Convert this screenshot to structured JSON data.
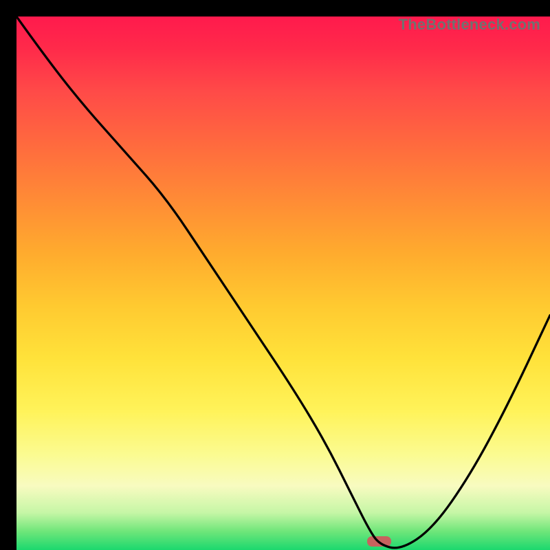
{
  "watermark": "TheBottleneck.com",
  "chart_data": {
    "type": "line",
    "title": "",
    "xlabel": "",
    "ylabel": "",
    "xlim": [
      0,
      100
    ],
    "ylim": [
      0,
      100
    ],
    "x": [
      0,
      5,
      12,
      20,
      28,
      36,
      44,
      52,
      58,
      63,
      66,
      68,
      72,
      78,
      85,
      92,
      100
    ],
    "values": [
      100,
      93,
      84,
      75,
      66,
      54,
      42,
      30,
      20,
      10,
      4,
      1,
      0,
      4,
      14,
      27,
      44
    ],
    "marker": {
      "x": 68,
      "width_pct": 4.5,
      "color": "#c7625e"
    },
    "gradient_stops": [
      {
        "pct": 0,
        "color": "#ff1a4d"
      },
      {
        "pct": 50,
        "color": "#ffc930"
      },
      {
        "pct": 88,
        "color": "#f8fbc0"
      },
      {
        "pct": 100,
        "color": "#1bd86e"
      }
    ]
  }
}
